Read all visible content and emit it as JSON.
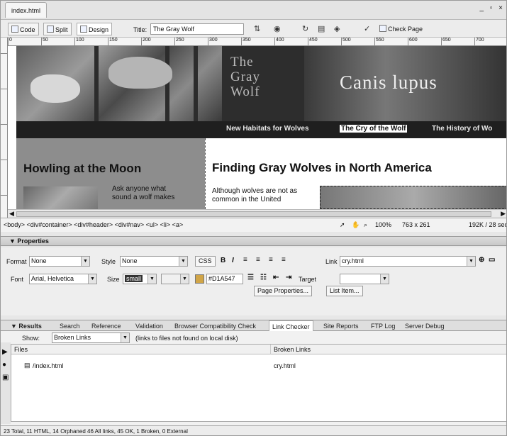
{
  "window": {
    "tab_title": "index.html",
    "controls": "_ ▫ ×"
  },
  "toolbar": {
    "code": "Code",
    "split": "Split",
    "design": "Design",
    "title_label": "Title:",
    "title_value": "The Gray Wolf",
    "check_page": "Check Page"
  },
  "ruler": {
    "ticks": [
      "0",
      "50",
      "100",
      "150",
      "200",
      "250",
      "300",
      "350",
      "400",
      "450",
      "500",
      "550",
      "600",
      "650",
      "700"
    ]
  },
  "page": {
    "site_title": [
      "The",
      "Gray",
      "Wolf"
    ],
    "banner": "Canis lupus",
    "nav": [
      "New Habitats for Wolves",
      "The Cry of the Wolf",
      "The History of Wo"
    ],
    "sidebar_heading": "Howling at the Moon",
    "sidebar_text": [
      "Ask anyone what",
      "sound a wolf makes"
    ],
    "main_heading": "Finding Gray Wolves in North America",
    "main_text": [
      "Although wolves are not as",
      "common in the United"
    ]
  },
  "statusbar": {
    "tag_path": "<body> <div#container> <div#header> <div#nav> <ul> <li> <a>",
    "zoom": "100%",
    "window_size": "763 x 261",
    "download": "192K / 28 sec"
  },
  "properties": {
    "title": "▼ Properties",
    "format_label": "Format",
    "format_value": "None",
    "style_label": "Style",
    "style_value": "None",
    "css_button": "CSS",
    "bold": "B",
    "italic": "I",
    "link_label": "Link",
    "link_value": "cry.html",
    "font_label": "Font",
    "font_value": "Arial, Helvetica",
    "size_label": "Size",
    "size_value": "small",
    "color_value": "#D1A547",
    "target_label": "Target",
    "page_props_button": "Page Properties...",
    "list_item_button": "List Item..."
  },
  "results": {
    "title": "▼ Results",
    "tabs": [
      "Search",
      "Reference",
      "Validation",
      "Browser Compatibility Check",
      "Link Checker",
      "Site Reports",
      "FTP Log",
      "Server Debug"
    ],
    "show_label": "Show:",
    "show_value": "Broken Links",
    "show_hint": "(links to files not found on local disk)",
    "columns": [
      "Files",
      "Broken Links"
    ],
    "rows": [
      {
        "file": "/index.html",
        "broken": "cry.html"
      }
    ],
    "summary": "23 Total, 11 HTML, 14 Orphaned 46 All links, 45 OK, 1 Broken, 0 External"
  },
  "colors": {
    "swatch": "#D1A547"
  }
}
